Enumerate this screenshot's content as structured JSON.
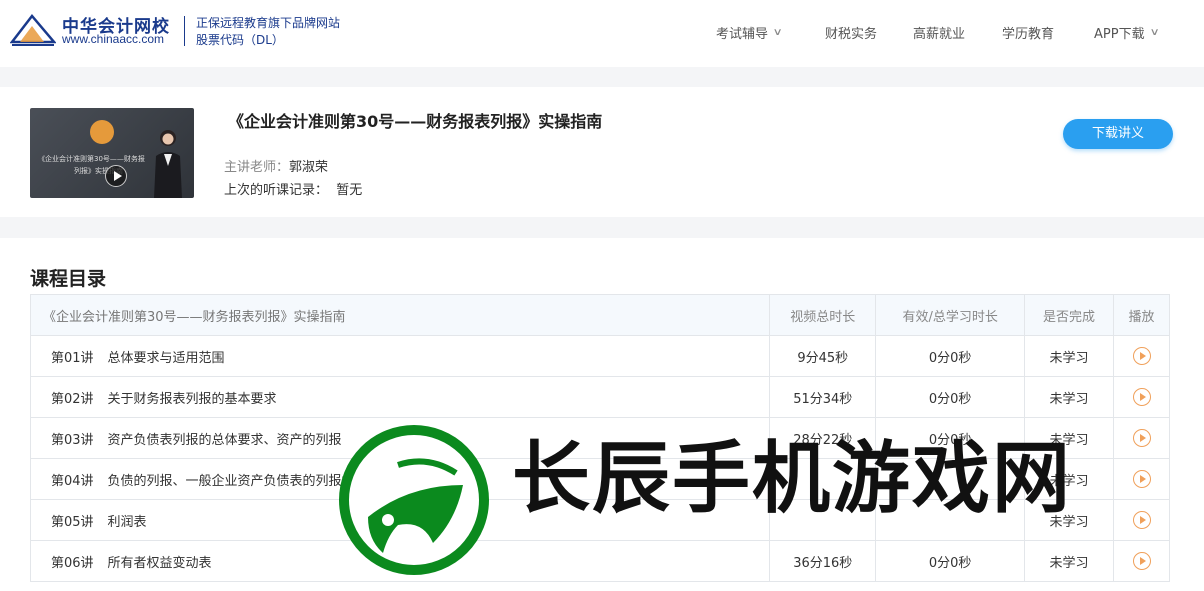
{
  "header": {
    "brand_cn": "中华会计网校",
    "brand_url": "www.chinaacc.com",
    "tagline1": "正保远程教育旗下品牌网站",
    "tagline2": "股票代码（DL）",
    "nav": [
      {
        "label": "考试辅导",
        "has_dropdown": true
      },
      {
        "label": "财税实务",
        "has_dropdown": false
      },
      {
        "label": "高薪就业",
        "has_dropdown": false
      },
      {
        "label": "学历教育",
        "has_dropdown": false
      },
      {
        "label": "APP下载",
        "has_dropdown": true
      }
    ]
  },
  "course": {
    "thumb_line1": "《企业会计准则第30号——财务报",
    "thumb_line2": "列报》实操指南",
    "title": "《企业会计准则第30号——财务报表列报》实操指南",
    "teacher_label": "主讲老师：",
    "teacher_name": "郭淑荣",
    "record_label": "上次的听课记录：",
    "record_value": "暂无",
    "download_label": "下载讲义"
  },
  "catalog": {
    "title": "课程目录",
    "columns": [
      "《企业会计准则第30号——财务报表列报》实操指南",
      "视频总时长",
      "有效/总学习时长",
      "是否完成",
      "播放"
    ],
    "rows": [
      {
        "no": "第01讲",
        "name": "总体要求与适用范围",
        "duration": "9分45秒",
        "learned": "0分0秒",
        "status": "未学习"
      },
      {
        "no": "第02讲",
        "name": "关于财务报表列报的基本要求",
        "duration": "51分34秒",
        "learned": "0分0秒",
        "status": "未学习"
      },
      {
        "no": "第03讲",
        "name": "资产负债表列报的总体要求、资产的列报",
        "duration": "28分22秒",
        "learned": "0分0秒",
        "status": "未学习"
      },
      {
        "no": "第04讲",
        "name": "负债的列报、一般企业资产负债表的列报格式和列报方法",
        "duration": "",
        "learned": "",
        "status": "未学习"
      },
      {
        "no": "第05讲",
        "name": "利润表",
        "duration": "",
        "learned": "",
        "status": "未学习"
      },
      {
        "no": "第06讲",
        "name": "所有者权益变动表",
        "duration": "36分16秒",
        "learned": "0分0秒",
        "status": "未学习"
      }
    ]
  },
  "watermark": {
    "text": "长辰手机游戏网",
    "color": "#0b8a1e"
  },
  "colors": {
    "brand": "#1a3a8c",
    "accent": "#2a9ff0",
    "status": "#2fb36b",
    "play": "#f0a05a"
  }
}
